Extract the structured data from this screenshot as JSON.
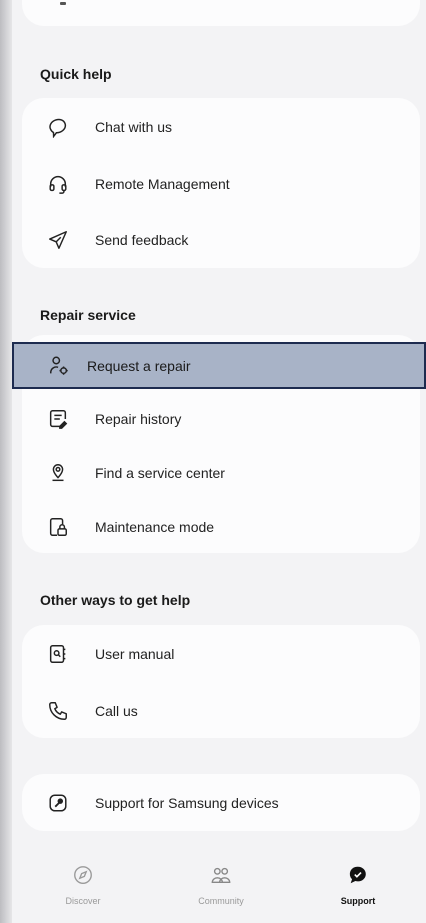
{
  "quick_help": {
    "title": "Quick help",
    "items": [
      {
        "label": "Chat with us",
        "icon": "chat-bubble-icon"
      },
      {
        "label": "Remote Management",
        "icon": "headset-icon"
      },
      {
        "label": "Send feedback",
        "icon": "paper-plane-icon"
      }
    ]
  },
  "repair_service": {
    "title": "Repair service",
    "items": [
      {
        "label": "Request a repair",
        "icon": "person-gear-icon"
      },
      {
        "label": "Repair history",
        "icon": "document-edit-icon"
      },
      {
        "label": "Find a service center",
        "icon": "location-pin-icon"
      },
      {
        "label": "Maintenance mode",
        "icon": "phone-lock-icon"
      }
    ]
  },
  "other_help": {
    "title": "Other ways to get help",
    "items": [
      {
        "label": "User manual",
        "icon": "manual-book-icon"
      },
      {
        "label": "Call us",
        "icon": "phone-icon"
      }
    ]
  },
  "samsung_support": {
    "label": "Support for Samsung devices",
    "icon": "wrench-icon"
  },
  "bottom_nav": {
    "items": [
      {
        "label": "Discover",
        "icon": "compass-icon",
        "active": false
      },
      {
        "label": "Community",
        "icon": "people-icon",
        "active": false
      },
      {
        "label": "Support",
        "icon": "support-chat-icon",
        "active": true
      }
    ]
  },
  "colors": {
    "background": "#f3f3f5",
    "card": "#fcfcfd",
    "highlight_fill": "#a8b3c7",
    "highlight_border": "#1d2b4f"
  }
}
